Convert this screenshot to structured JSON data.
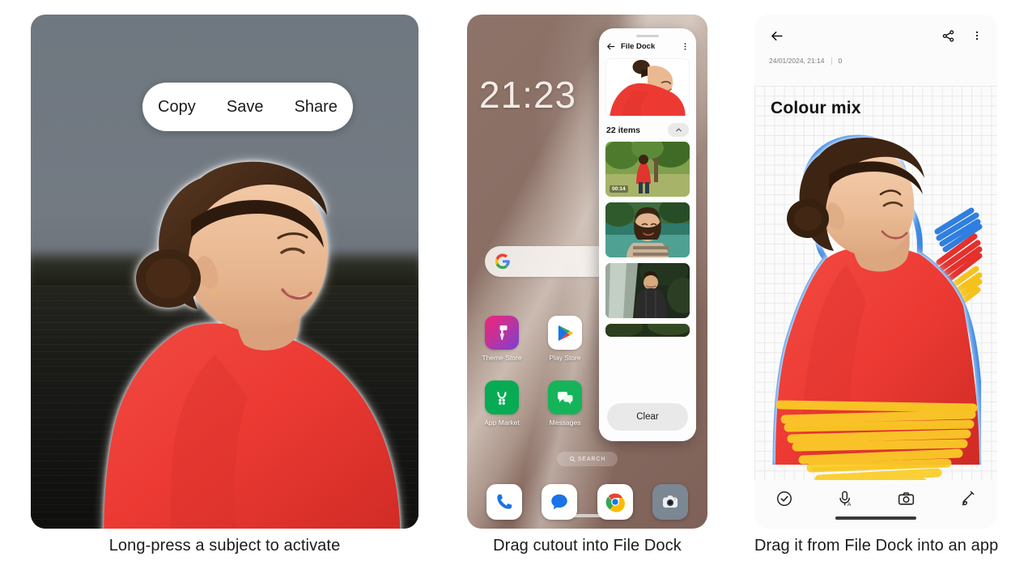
{
  "panels": [
    {
      "caption": "Long-press a subject to activate",
      "context_menu": {
        "items": [
          "Copy",
          "Save",
          "Share"
        ]
      }
    },
    {
      "caption": "Drag cutout into File Dock",
      "home": {
        "clock": "21:23",
        "search_widget_icon": "google-g-icon",
        "search_pill_label": "SEARCH",
        "search_pill_icon": "search-icon",
        "apps": [
          {
            "label": "Theme Store",
            "icon": "theme-store-icon"
          },
          {
            "label": "Play Store",
            "icon": "play-store-icon"
          },
          {
            "label": "App Market",
            "icon": "app-market-icon"
          },
          {
            "label": "Messages",
            "icon": "messages-icon"
          }
        ],
        "dock": [
          {
            "label": "Phone",
            "icon": "phone-icon"
          },
          {
            "label": "Messages",
            "icon": "messages-blue-icon"
          },
          {
            "label": "Chrome",
            "icon": "chrome-icon"
          },
          {
            "label": "Camera",
            "icon": "camera-icon"
          }
        ]
      },
      "file_dock": {
        "title": "File Dock",
        "back_icon": "back-arrow-icon",
        "menu_icon": "more-vertical-icon",
        "count_label": "22 items",
        "collapse_icon": "chevron-up-icon",
        "clear_label": "Clear",
        "items": [
          {
            "type": "image",
            "desc": "red-sweater-cutout"
          },
          {
            "type": "video",
            "duration": "00:14",
            "desc": "person-in-red-forest"
          },
          {
            "type": "image",
            "desc": "woman-by-river"
          },
          {
            "type": "image",
            "desc": "man-by-waterfall"
          },
          {
            "type": "image",
            "desc": "partial-thumbnail"
          }
        ]
      }
    },
    {
      "caption": "Drag it from File Dock into an app",
      "note": {
        "back_icon": "back-arrow-icon",
        "share_icon": "share-icon",
        "menu_icon": "more-vertical-icon",
        "timestamp": "24/01/2024, 21:14",
        "counter": "0",
        "title": "Colour mix",
        "toolbar": [
          {
            "name": "check-circle-icon"
          },
          {
            "name": "voice-input-icon"
          },
          {
            "name": "camera-icon"
          },
          {
            "name": "pen-icon"
          }
        ]
      }
    }
  ],
  "colors": {
    "sweater_red": "#ec3a33",
    "doodle_blue": "#2f7fe0",
    "doodle_red": "#e5302c",
    "doodle_yellow": "#f5c21c",
    "highlighter_yellow": "#fbcd28",
    "outline_blue": "#2f7fe0",
    "wallpaper": "#8a6f65",
    "note_bg": "#fbfbfb",
    "grid_line": "#e9e9ec"
  }
}
